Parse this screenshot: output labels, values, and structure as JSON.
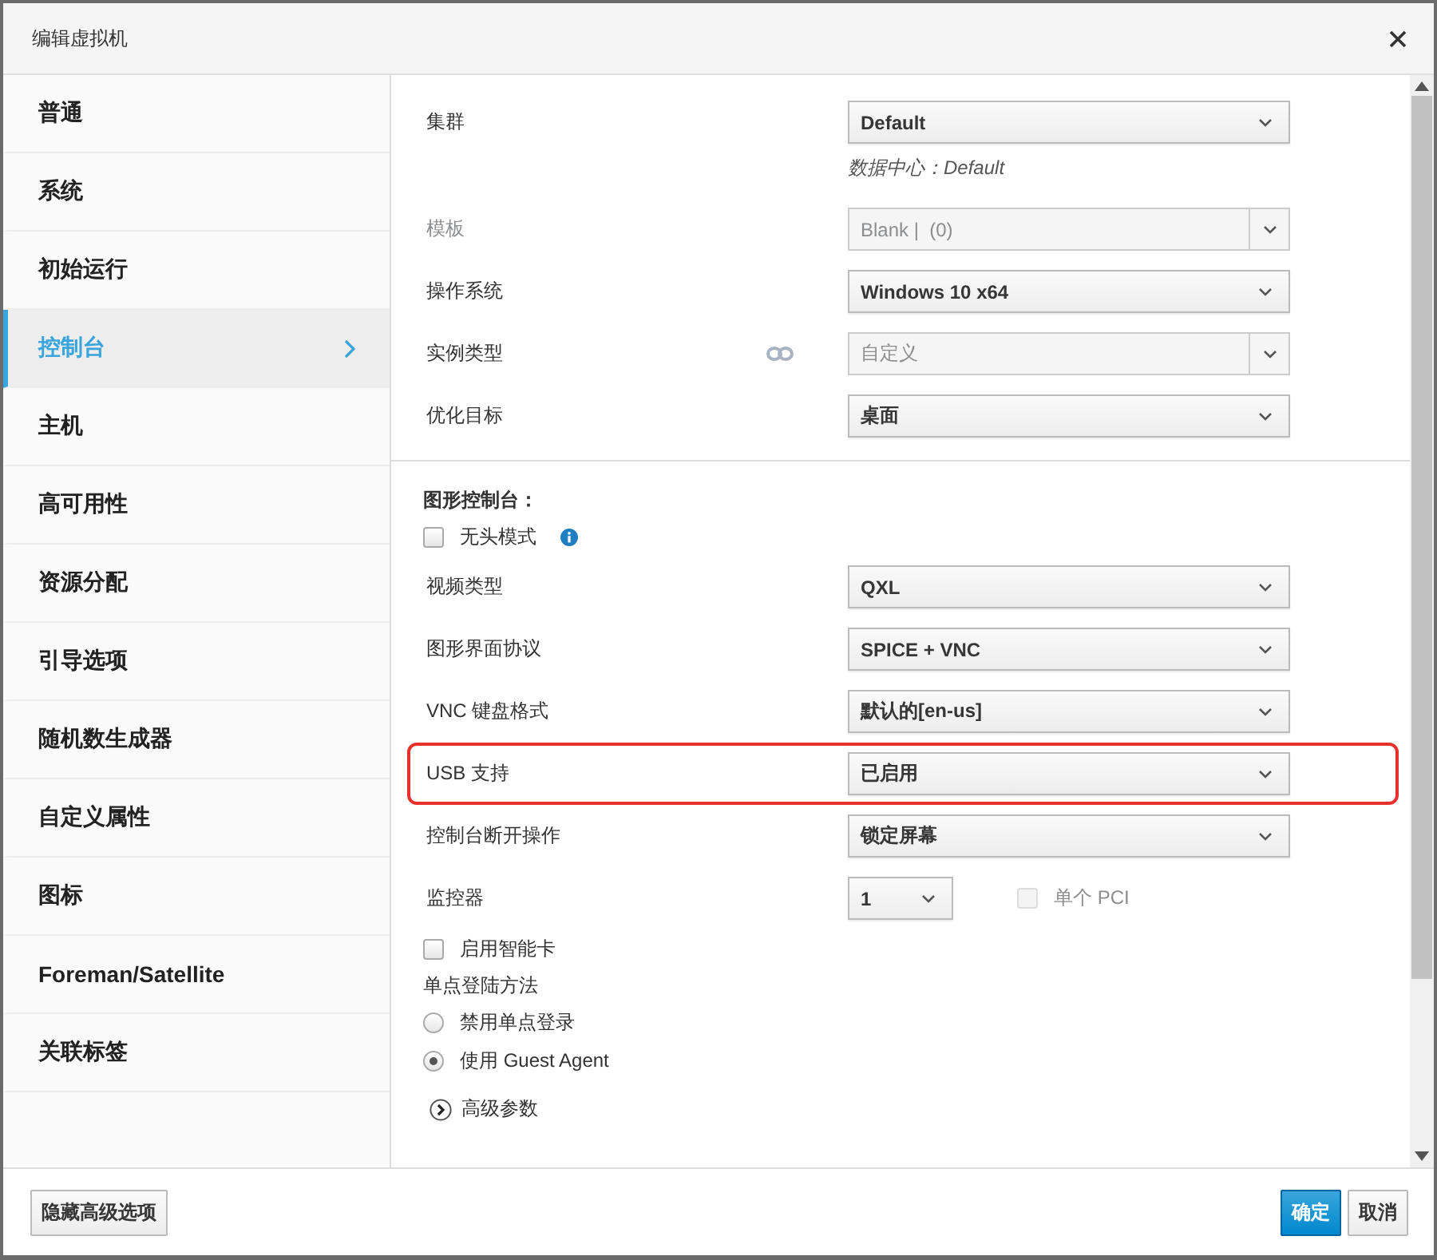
{
  "dialog": {
    "title": "编辑虚拟机"
  },
  "sidebar": {
    "items": [
      {
        "label": "普通",
        "selected": false
      },
      {
        "label": "系统",
        "selected": false
      },
      {
        "label": "初始运行",
        "selected": false
      },
      {
        "label": "控制台",
        "selected": true
      },
      {
        "label": "主机",
        "selected": false
      },
      {
        "label": "高可用性",
        "selected": false
      },
      {
        "label": "资源分配",
        "selected": false
      },
      {
        "label": "引导选项",
        "selected": false
      },
      {
        "label": "随机数生成器",
        "selected": false
      },
      {
        "label": "自定义属性",
        "selected": false
      },
      {
        "label": "图标",
        "selected": false
      },
      {
        "label": "Foreman/Satellite",
        "selected": false
      },
      {
        "label": "关联标签",
        "selected": false
      }
    ]
  },
  "fields": [
    {
      "kind": "select",
      "label": "集群",
      "value": "Default",
      "note": "数据中心：Default",
      "highlighted": false
    },
    {
      "kind": "split",
      "label": "模板",
      "value": "Blank |  (0)",
      "label_disabled": true,
      "disabled": true
    },
    {
      "kind": "select",
      "label": "操作系统",
      "value": "Windows 10 x64",
      "highlighted": false
    },
    {
      "kind": "split-linked",
      "label": "实例类型",
      "value": "自定义",
      "label_disabled": false,
      "disabled": true
    },
    {
      "kind": "select",
      "label": "优化目标",
      "value": "桌面",
      "highlighted": false
    },
    {
      "kind": "heading",
      "label": "图形控制台："
    },
    {
      "kind": "checkbox-info",
      "label": "无头模式",
      "checked": false
    },
    {
      "kind": "select",
      "label": "视频类型",
      "value": "QXL",
      "highlighted": false
    },
    {
      "kind": "select",
      "label": "图形界面协议",
      "value": "SPICE + VNC",
      "highlighted": false
    },
    {
      "kind": "select",
      "label": "VNC 键盘格式",
      "value": "默认的[en-us]",
      "highlighted": false
    },
    {
      "kind": "select",
      "label": "USB 支持",
      "value": "已启用",
      "highlighted": true
    },
    {
      "kind": "select",
      "label": "控制台断开操作",
      "value": "锁定屏幕",
      "highlighted": false
    },
    {
      "kind": "monitor",
      "label": "监控器",
      "value": "1",
      "option": {
        "label": "单个 PCI",
        "checked": false,
        "disabled": true
      }
    },
    {
      "kind": "checkbox",
      "label": "启用智能卡",
      "checked": false
    },
    {
      "kind": "text",
      "label": "单点登陆方法"
    },
    {
      "kind": "radio",
      "label": "禁用单点登录",
      "selected": false
    },
    {
      "kind": "radio",
      "label": "使用 Guest Agent",
      "selected": true
    },
    {
      "kind": "expander",
      "label": "高级参数",
      "expanded": false
    }
  ],
  "footer": {
    "left_buttons": [
      {
        "label": "隐藏高级选项"
      }
    ],
    "right_buttons": [
      {
        "label": "确定",
        "kind": "primary"
      },
      {
        "label": "取消",
        "kind": "default"
      }
    ]
  }
}
